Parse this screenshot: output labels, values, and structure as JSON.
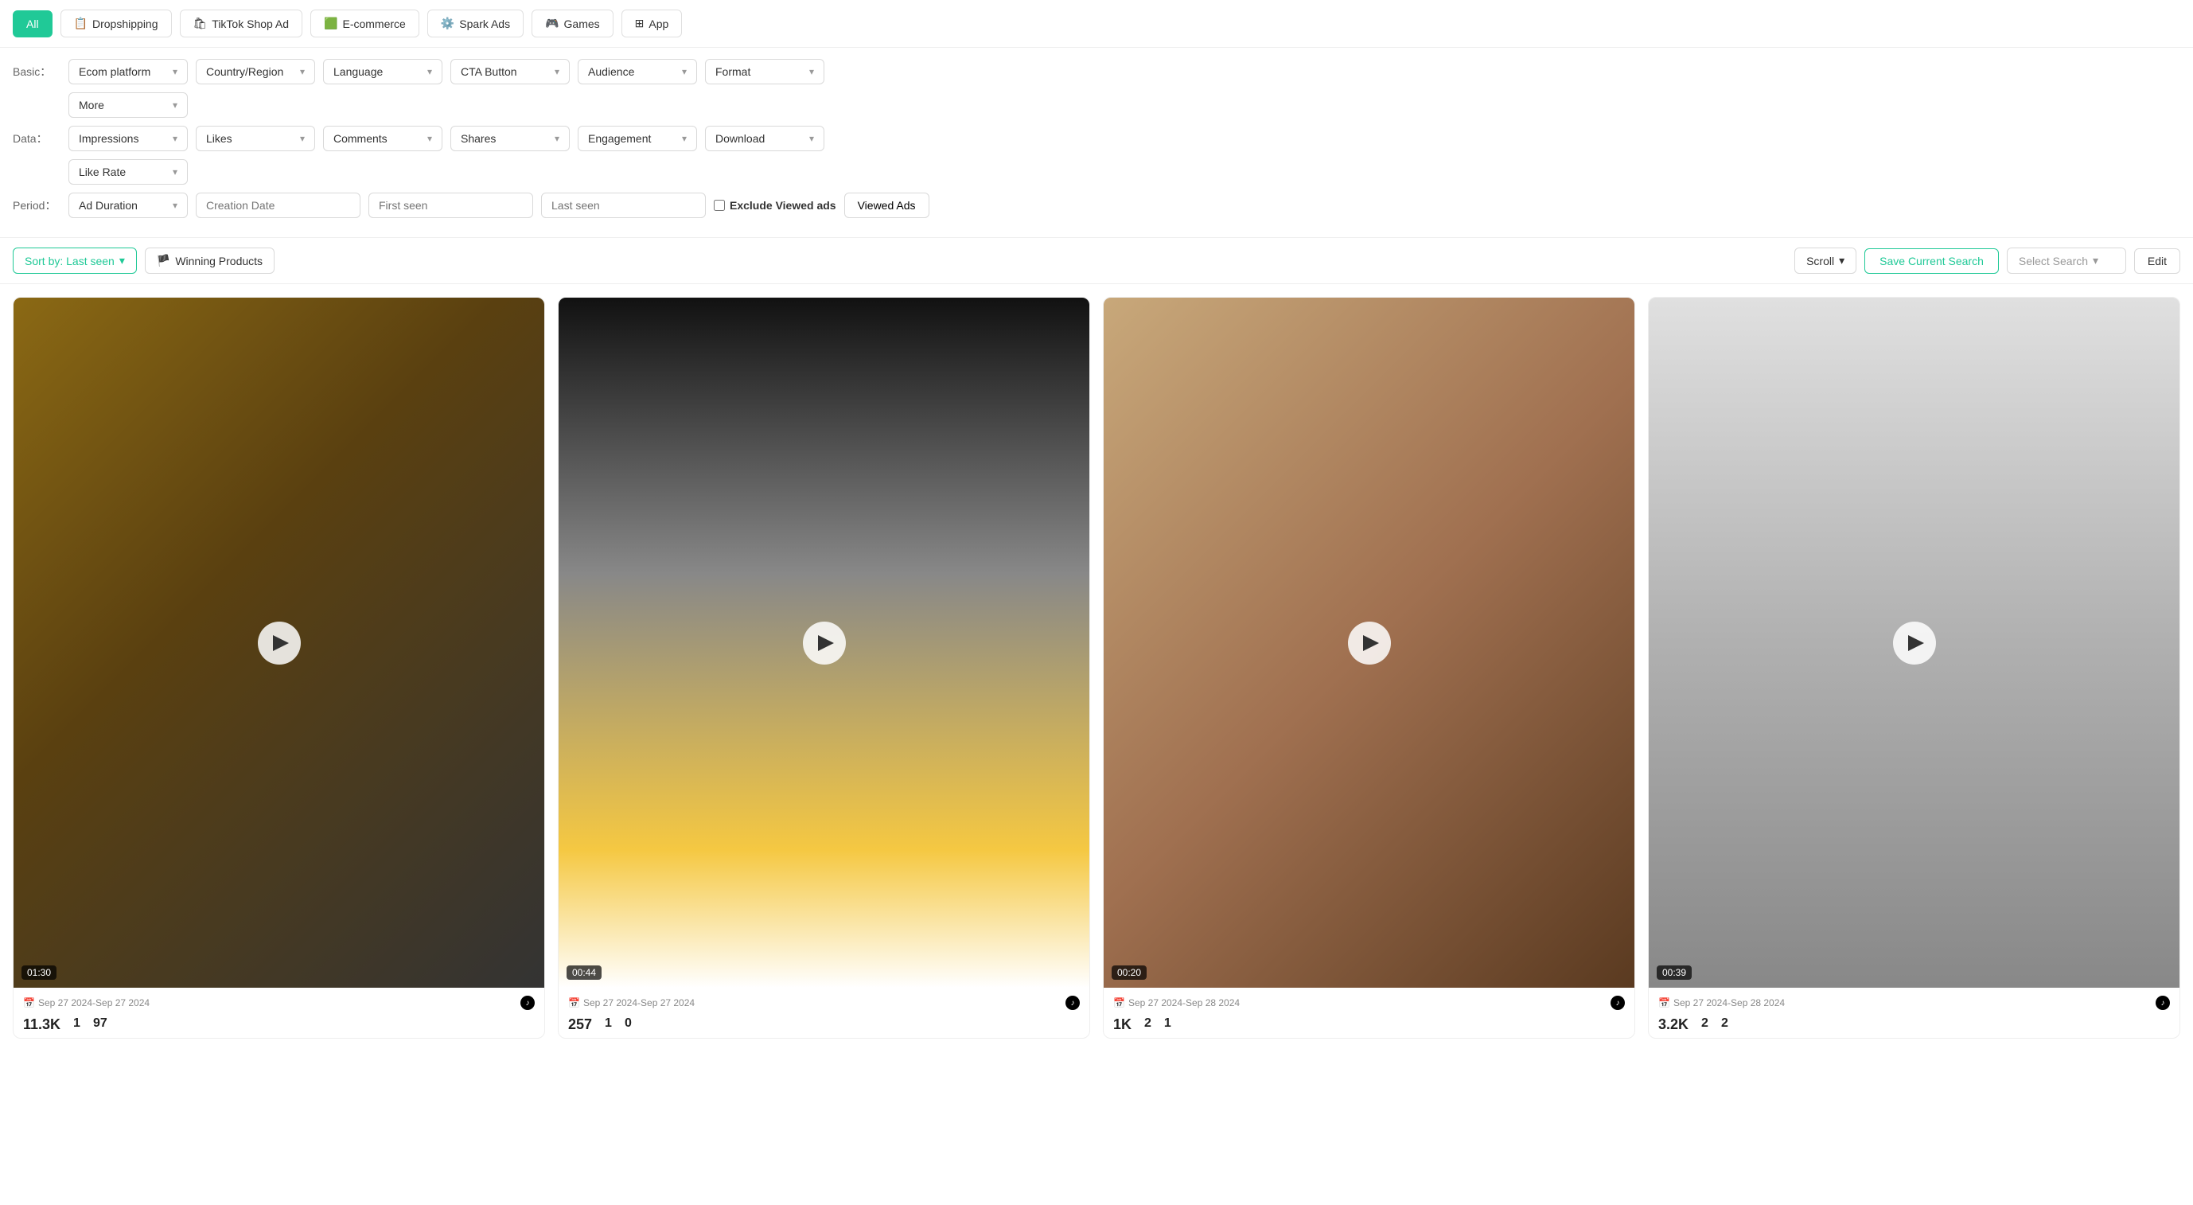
{
  "tabs": [
    {
      "label": "All",
      "active": true,
      "icon": ""
    },
    {
      "label": "Dropshipping",
      "active": false,
      "icon": "📋"
    },
    {
      "label": "TikTok Shop Ad",
      "active": false,
      "icon": "🛍"
    },
    {
      "label": "E-commerce",
      "active": false,
      "icon": "🟩"
    },
    {
      "label": "Spark Ads",
      "active": false,
      "icon": "⚙️"
    },
    {
      "label": "Games",
      "active": false,
      "icon": "🎮"
    },
    {
      "label": "App",
      "active": false,
      "icon": "⊞"
    }
  ],
  "filters": {
    "basic_label": "Basic：",
    "data_label": "Data：",
    "period_label": "Period：",
    "basic_dropdowns": [
      {
        "label": "Ecom platform"
      },
      {
        "label": "Country/Region"
      },
      {
        "label": "Language"
      },
      {
        "label": "CTA Button"
      },
      {
        "label": "Audience"
      },
      {
        "label": "Format"
      }
    ],
    "more_dropdown": {
      "label": "More"
    },
    "data_dropdowns": [
      {
        "label": "Impressions"
      },
      {
        "label": "Likes"
      },
      {
        "label": "Comments"
      },
      {
        "label": "Shares"
      },
      {
        "label": "Engagement"
      },
      {
        "label": "Download"
      }
    ],
    "like_rate_dropdown": {
      "label": "Like Rate"
    },
    "period_ad_duration": {
      "label": "Ad Duration"
    },
    "period_creation_date": {
      "placeholder": "Creation Date"
    },
    "period_first_seen": {
      "placeholder": "First seen"
    },
    "period_last_seen": {
      "placeholder": "Last seen"
    },
    "exclude_label": "Exclude Viewed ads",
    "viewed_ads_label": "Viewed Ads"
  },
  "toolbar": {
    "sort_label": "Sort by: Last seen",
    "winning_label": "Winning Products",
    "scroll_label": "Scroll",
    "save_label": "Save Current Search",
    "select_search_label": "Select Search",
    "edit_label": "Edit"
  },
  "cards": [
    {
      "duration": "01:30",
      "date": "Sep 27 2024-Sep 27 2024",
      "views": "11.3K",
      "likes": "1",
      "comments": "97",
      "bg_class": "card-1-bg"
    },
    {
      "duration": "00:44",
      "date": "Sep 27 2024-Sep 27 2024",
      "views": "257",
      "likes": "1",
      "comments": "0",
      "bg_class": "card-2-bg"
    },
    {
      "duration": "00:20",
      "date": "Sep 27 2024-Sep 28 2024",
      "views": "1K",
      "likes": "2",
      "comments": "1",
      "bg_class": "card-3-bg"
    },
    {
      "duration": "00:39",
      "date": "Sep 27 2024-Sep 28 2024",
      "views": "3.2K",
      "likes": "2",
      "comments": "2",
      "bg_class": "card-4-bg"
    }
  ]
}
